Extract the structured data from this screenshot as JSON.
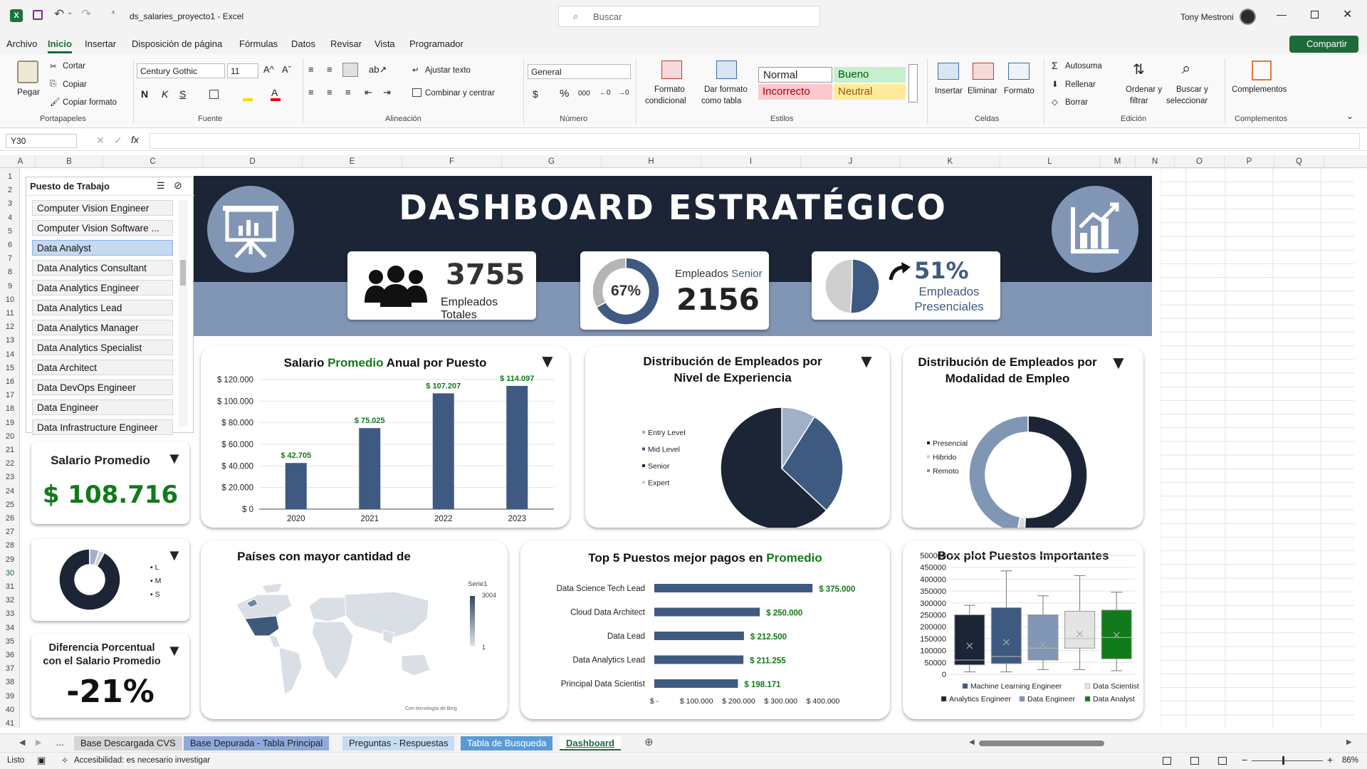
{
  "window": {
    "file_title": "ds_salaries_proyecto1 - Excel",
    "search_placeholder": "Buscar",
    "user": "Tony Mestroni"
  },
  "menu": [
    "Archivo",
    "Inicio",
    "Insertar",
    "Disposición de página",
    "Fórmulas",
    "Datos",
    "Revisar",
    "Vista",
    "Programador"
  ],
  "share_label": "Compartir",
  "ribbon": {
    "clipboard": {
      "paste": "Pegar",
      "cut": "Cortar",
      "copy": "Copiar",
      "format_painter": "Copiar formato",
      "group": "Portapapeles"
    },
    "font": {
      "name": "Century Gothic",
      "size": "11",
      "group": "Fuente"
    },
    "alignment": {
      "wrap": "Ajustar texto",
      "merge": "Combinar y centrar",
      "group": "Alineación"
    },
    "number": {
      "format": "General",
      "group": "Número"
    },
    "styles": {
      "cond_format_1": "Formato",
      "cond_format_2": "condicional",
      "table_format_1": "Dar formato",
      "table_format_2": "como tabla",
      "normal": "Normal",
      "good": "Bueno",
      "bad": "Incorrecto",
      "neutral": "Neutral",
      "group": "Estilos"
    },
    "cells": {
      "insert": "Insertar",
      "delete": "Eliminar",
      "format": "Formato",
      "group": "Celdas"
    },
    "editing": {
      "autosum": "Autosuma",
      "fill": "Rellenar",
      "clear": "Borrar",
      "sort_1": "Ordenar y",
      "sort_2": "filtrar",
      "find_1": "Buscar y",
      "find_2": "seleccionar",
      "group": "Edición"
    },
    "addins": {
      "label": "Complementos",
      "group": "Complementos"
    }
  },
  "formula": {
    "namebox": "Y30",
    "fx": "fx"
  },
  "columns": [
    "A",
    "B",
    "C",
    "D",
    "E",
    "F",
    "G",
    "H",
    "I",
    "J",
    "K",
    "L",
    "M",
    "N",
    "O",
    "P",
    "Q"
  ],
  "rows": [
    "1",
    "2",
    "3",
    "4",
    "5",
    "6",
    "7",
    "8",
    "9",
    "10",
    "11",
    "12",
    "13",
    "14",
    "15",
    "16",
    "17",
    "18",
    "19",
    "20",
    "21",
    "22",
    "23",
    "24",
    "25",
    "26",
    "27",
    "28",
    "29",
    "30",
    "31",
    "32",
    "33",
    "34",
    "35",
    "36",
    "37",
    "38",
    "39",
    "40",
    "41"
  ],
  "slicer": {
    "title": "Puesto de Trabajo",
    "items": [
      "Computer Vision Engineer",
      "Computer Vision Software ...",
      "Data Analyst",
      "Data Analytics Consultant",
      "Data Analytics Engineer",
      "Data Analytics Lead",
      "Data Analytics Manager",
      "Data Analytics Specialist",
      "Data Architect",
      "Data DevOps Engineer",
      "Data Engineer",
      "Data Infrastructure Engineer"
    ],
    "selected_index": 2
  },
  "header": {
    "title": "DASHBOARD ESTRATÉGICO"
  },
  "kpi": {
    "total_value": "3755",
    "total_label": "Empleados Totales",
    "senior_pct": "67%",
    "senior_label_1": "Empleados ",
    "senior_label_2": "Senior",
    "senior_value": "2156",
    "onsite_value": "51%",
    "onsite_label_1": "Empleados",
    "onsite_label_2": "Presenciales"
  },
  "salary": {
    "title": "Salario Promedio",
    "value": "$ 108.716"
  },
  "diff": {
    "title_1": "Diferencia Porcentual",
    "title_2": "con el Salario Promedio",
    "value": "-21%"
  },
  "size_donut": {
    "legend": [
      "L",
      "M",
      "S"
    ]
  },
  "colors": {
    "navy": "#1c2536",
    "slate": "#3f5a80",
    "mid": "#6f86a6",
    "light": "#9fb0c7",
    "band": "#8196b5",
    "green": "#117a1a"
  },
  "chart_data": [
    {
      "id": "salary_by_year",
      "type": "bar",
      "title_1": "Salario ",
      "title_2": "Promedio",
      "title_3": " Anual por Puesto",
      "categories": [
        "2020",
        "2021",
        "2022",
        "2023"
      ],
      "values": [
        42705,
        75025,
        107207,
        114097
      ],
      "data_labels": [
        "$ 42.705",
        "$ 75.025",
        "$ 107.207",
        "$ 114.097"
      ],
      "ylim": [
        0,
        120000
      ],
      "yticks": [
        "$ 0",
        "$ 20.000",
        "$ 40.000",
        "$ 60.000",
        "$ 80.000",
        "$ 100.000",
        "$ 120.000"
      ],
      "grid": true
    },
    {
      "id": "experience",
      "type": "pie",
      "title_1": "Distribución de Empleados por",
      "title_2": "Nivel de Experiencia",
      "legend": [
        "Entry Level",
        "Mid Level",
        "Senior",
        "Expert"
      ],
      "values": [
        9,
        28,
        63,
        0
      ]
    },
    {
      "id": "modality",
      "type": "pie",
      "title_1": "Distribución de Empleados por",
      "title_2": "Modalidad de Empleo",
      "legend": [
        "Presencial",
        "Hibrido",
        "Remoto"
      ],
      "values": [
        51,
        2,
        47
      ]
    },
    {
      "id": "senior_donut",
      "type": "pie",
      "values": [
        67,
        33
      ]
    },
    {
      "id": "onsite_pie",
      "type": "pie",
      "values": [
        51,
        49
      ]
    },
    {
      "id": "size",
      "type": "pie",
      "values": [
        92,
        5,
        3
      ],
      "legend": [
        "L",
        "M",
        "S"
      ]
    },
    {
      "id": "countries",
      "type": "map",
      "title": "Países con mayor cantidad de",
      "legend_title": "Serie1",
      "scale_max": "3004",
      "scale_min": "1",
      "credit": "Con tecnología de Bing"
    },
    {
      "id": "top5",
      "type": "bar",
      "title_1": "Top 5 Puestos mejor pagos en ",
      "title_2": "Promedio",
      "categories": [
        "Data Science Tech Lead",
        "Cloud Data Architect",
        "Data Lead",
        "Data Analytics Lead",
        "Principal Data Scientist"
      ],
      "values": [
        375000,
        250000,
        212500,
        211255,
        198171
      ],
      "data_labels": [
        "$ 375.000",
        "$ 250.000",
        "$ 212.500",
        "$ 211.255",
        "$ 198.171"
      ],
      "xlim": [
        0,
        400000
      ],
      "xticks": [
        "$ -",
        "$ 100.000",
        "$ 200.000",
        "$ 300.000",
        "$ 400.000"
      ]
    },
    {
      "id": "boxplot",
      "type": "box",
      "title": "Box plot Puestos Importantes",
      "yticks": [
        "0",
        "50000",
        "100000",
        "150000",
        "200000",
        "250000",
        "300000",
        "350000",
        "400000",
        "450000",
        "500000"
      ],
      "ylim": [
        0,
        500000
      ],
      "series": [
        {
          "name": "Analytics Engineer",
          "color": "#1c2536",
          "min": 10000,
          "q1": 40000,
          "median": 60000,
          "q3": 250000,
          "max": 290000,
          "mean": 120000
        },
        {
          "name": "Machine Learning Engineer",
          "color": "#3f5a80",
          "min": 10000,
          "q1": 45000,
          "median": 75000,
          "q3": 280000,
          "max": 435000,
          "mean": 135000
        },
        {
          "name": "Data Engineer",
          "color": "#8196b5",
          "min": 20000,
          "q1": 60000,
          "median": 110000,
          "q3": 250000,
          "max": 330000,
          "mean": 125000
        },
        {
          "name": "Data Scientist",
          "color": "#e4e4e4",
          "min": 20000,
          "q1": 110000,
          "median": 150000,
          "q3": 265000,
          "max": 415000,
          "mean": 170000
        },
        {
          "name": "Data Analyst",
          "color": "#117a1a",
          "min": 15000,
          "q1": 65000,
          "median": 155000,
          "q3": 270000,
          "max": 345000,
          "mean": 165000
        }
      ]
    }
  ],
  "sheet_tabs": [
    "Base Descargada CVS",
    "Base Depurada - Tabla Principal",
    "Preguntas - Respuestas",
    "Tabla de Busqueda",
    "Dashboard"
  ],
  "sheet_tabs_nav": "...",
  "status": {
    "ready": "Listo",
    "accessibility": "Accesibilidad: es necesario investigar",
    "zoom": "86%"
  }
}
